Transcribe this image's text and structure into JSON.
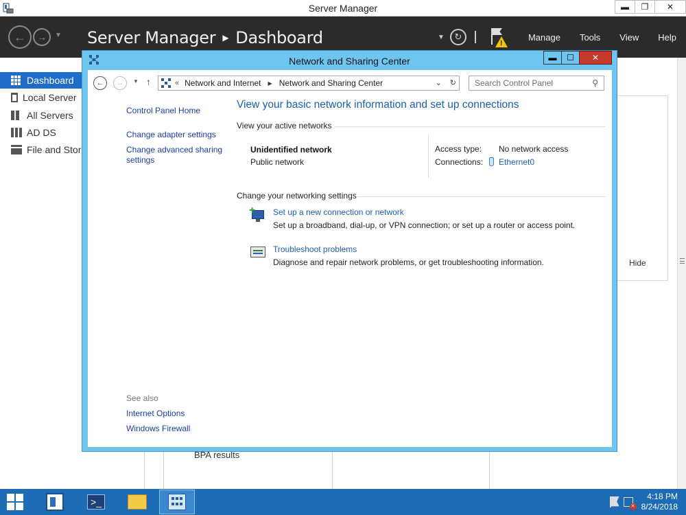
{
  "server_manager": {
    "window_title": "Server Manager",
    "breadcrumb": {
      "root": "Server Manager",
      "current": "Dashboard"
    },
    "menus": [
      "Manage",
      "Tools",
      "View",
      "Help"
    ],
    "nav": [
      {
        "label": "Dashboard",
        "icon": "dashboard-icon",
        "active": true
      },
      {
        "label": "Local Server",
        "icon": "server-icon",
        "active": false
      },
      {
        "label": "All Servers",
        "icon": "servers-icon",
        "active": false
      },
      {
        "label": "AD DS",
        "icon": "adds-icon",
        "active": false
      },
      {
        "label": "File and Stora",
        "icon": "file-storage-icon",
        "active": false
      }
    ],
    "hide_label": "Hide",
    "bpa_label": "BPA results"
  },
  "nsc": {
    "window_title": "Network and Sharing Center",
    "address": {
      "prefix": "«",
      "segments": [
        "Network and Internet",
        "Network and Sharing Center"
      ]
    },
    "search_placeholder": "Search Control Panel",
    "sidebar": {
      "home": "Control Panel Home",
      "adapter": "Change adapter settings",
      "advanced_line1": "Change advanced sharing",
      "advanced_line2": "settings",
      "see_also": "See also",
      "internet_options": "Internet Options",
      "firewall": "Windows Firewall"
    },
    "heading": "View your basic network information and set up connections",
    "active_networks_label": "View your active networks",
    "network": {
      "name": "Unidentified network",
      "type": "Public network",
      "access_type_label": "Access type:",
      "access_type_value": "No network access",
      "connections_label": "Connections:",
      "connections_value": "Ethernet0"
    },
    "change_settings_label": "Change your networking settings",
    "tasks": [
      {
        "title": "Set up a new connection or network",
        "desc": "Set up a broadband, dial-up, or VPN connection; or set up a router or access point.",
        "icon": "new-connection-icon"
      },
      {
        "title": "Troubleshoot problems",
        "desc": "Diagnose and repair network problems, or get troubleshooting information.",
        "icon": "troubleshoot-icon"
      }
    ]
  },
  "taskbar": {
    "time": "4:18 PM",
    "date": "8/24/2018"
  },
  "colors": {
    "accent": "#1f6dc8",
    "header_bg": "#2b2b2b",
    "nsc_frame": "#6ec6f0",
    "link": "#1a5fb4",
    "taskbar": "#1c6bb4",
    "close_red": "#c7392c"
  }
}
